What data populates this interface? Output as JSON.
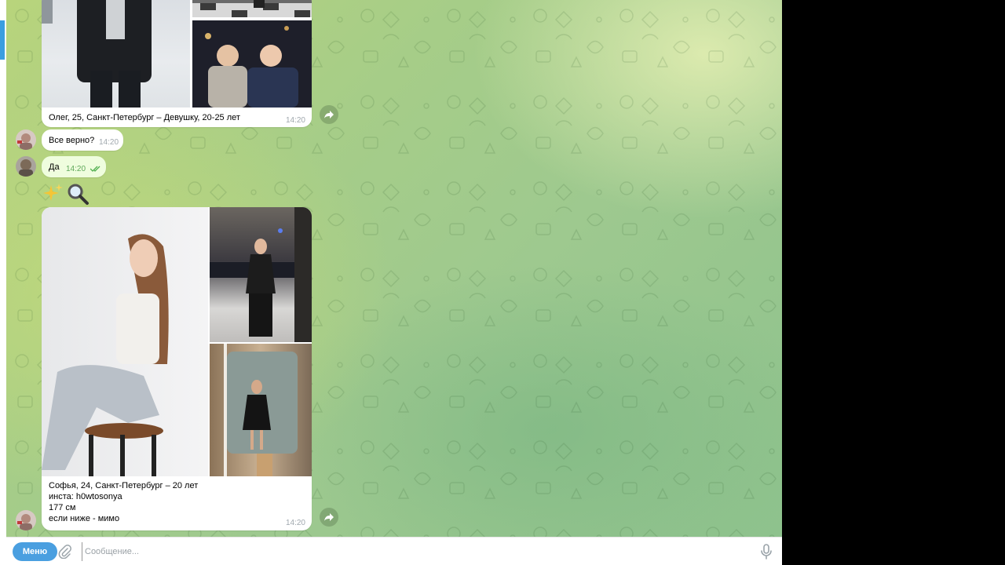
{
  "chat": {
    "album1": {
      "caption": "Олег, 25, Санкт-Петербург – Девушку, 20-25 лет",
      "time": "14:20"
    },
    "msg_question": {
      "text": "Все верно?",
      "time": "14:20"
    },
    "msg_reply": {
      "text": "Да",
      "time": "14:20",
      "status": "read"
    },
    "emoji_line": "✨🔍",
    "album2": {
      "caption_lines": [
        "Софья, 24, Санкт-Петербург – 20 лет",
        "инста: h0wtosonya",
        "177 см",
        "если ниже - мимо"
      ],
      "time": "14:20"
    }
  },
  "composer": {
    "menu_label": "Меню",
    "placeholder": "Сообщение...",
    "attach_icon": "paperclip-icon",
    "mic_icon": "microphone-icon"
  },
  "colors": {
    "accent": "#4a9fe0",
    "outgoing_bubble": "#effdde",
    "read_check": "#4fae4e"
  }
}
